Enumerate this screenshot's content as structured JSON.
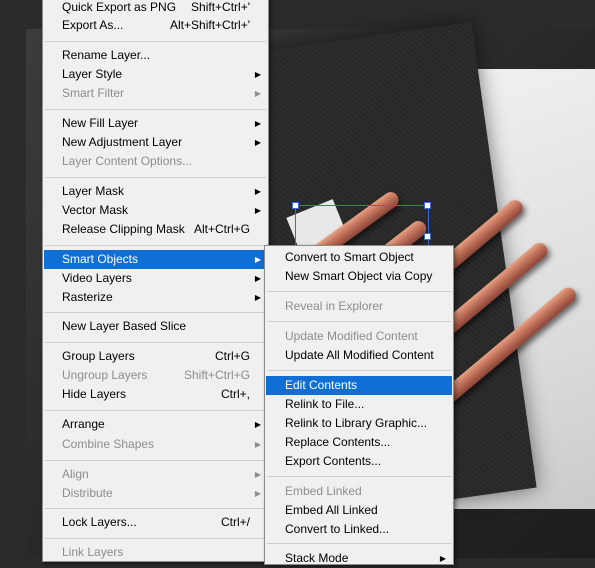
{
  "main_menu": {
    "items": [
      {
        "label": "Quick Export as PNG",
        "shortcut": "Shift+Ctrl+'",
        "disabled": false
      },
      {
        "label": "Export As...",
        "shortcut": "Alt+Shift+Ctrl+'",
        "disabled": false
      },
      {
        "label": "Rename Layer...",
        "shortcut": "",
        "disabled": false
      },
      {
        "label": "Layer Style",
        "shortcut": "",
        "disabled": false,
        "submenu": true
      },
      {
        "label": "Smart Filter",
        "shortcut": "",
        "disabled": true,
        "submenu": true
      },
      {
        "label": "New Fill Layer",
        "shortcut": "",
        "disabled": false,
        "submenu": true
      },
      {
        "label": "New Adjustment Layer",
        "shortcut": "",
        "disabled": false,
        "submenu": true
      },
      {
        "label": "Layer Content Options...",
        "shortcut": "",
        "disabled": true
      },
      {
        "label": "Layer Mask",
        "shortcut": "",
        "disabled": false,
        "submenu": true
      },
      {
        "label": "Vector Mask",
        "shortcut": "",
        "disabled": false,
        "submenu": true
      },
      {
        "label": "Release Clipping Mask",
        "shortcut": "Alt+Ctrl+G",
        "disabled": false
      },
      {
        "label": "Smart Objects",
        "shortcut": "",
        "disabled": false,
        "submenu": true,
        "highlighted": true
      },
      {
        "label": "Video Layers",
        "shortcut": "",
        "disabled": false,
        "submenu": true
      },
      {
        "label": "Rasterize",
        "shortcut": "",
        "disabled": false,
        "submenu": true
      },
      {
        "label": "New Layer Based Slice",
        "shortcut": "",
        "disabled": false
      },
      {
        "label": "Group Layers",
        "shortcut": "Ctrl+G",
        "disabled": false
      },
      {
        "label": "Ungroup Layers",
        "shortcut": "Shift+Ctrl+G",
        "disabled": true
      },
      {
        "label": "Hide Layers",
        "shortcut": "Ctrl+,",
        "disabled": false
      },
      {
        "label": "Arrange",
        "shortcut": "",
        "disabled": false,
        "submenu": true
      },
      {
        "label": "Combine Shapes",
        "shortcut": "",
        "disabled": true,
        "submenu": true
      },
      {
        "label": "Align",
        "shortcut": "",
        "disabled": true,
        "submenu": true
      },
      {
        "label": "Distribute",
        "shortcut": "",
        "disabled": true,
        "submenu": true
      },
      {
        "label": "Lock Layers...",
        "shortcut": "Ctrl+/",
        "disabled": false
      },
      {
        "label": "Link Layers",
        "shortcut": "",
        "disabled": true
      }
    ]
  },
  "smart_objects_submenu": {
    "items": [
      {
        "label": "Convert to Smart Object",
        "disabled": false
      },
      {
        "label": "New Smart Object via Copy",
        "disabled": false
      },
      {
        "label": "Reveal in Explorer",
        "disabled": true
      },
      {
        "label": "Update Modified Content",
        "disabled": true
      },
      {
        "label": "Update All Modified Content",
        "disabled": false
      },
      {
        "label": "Edit Contents",
        "disabled": false,
        "highlighted": true
      },
      {
        "label": "Relink to File...",
        "disabled": false
      },
      {
        "label": "Relink to Library Graphic...",
        "disabled": false
      },
      {
        "label": "Replace Contents...",
        "disabled": false
      },
      {
        "label": "Export Contents...",
        "disabled": false
      },
      {
        "label": "Embed Linked",
        "disabled": true
      },
      {
        "label": "Embed All Linked",
        "disabled": false
      },
      {
        "label": "Convert to Linked...",
        "disabled": false
      },
      {
        "label": "Stack Mode",
        "disabled": false,
        "submenu": true
      }
    ]
  },
  "colors": {
    "highlight": "#0f6fd4",
    "menu_bg": "#f0f0f0",
    "disabled_text": "#8d8d8d"
  },
  "icons": {
    "submenu_arrow": "▶"
  }
}
